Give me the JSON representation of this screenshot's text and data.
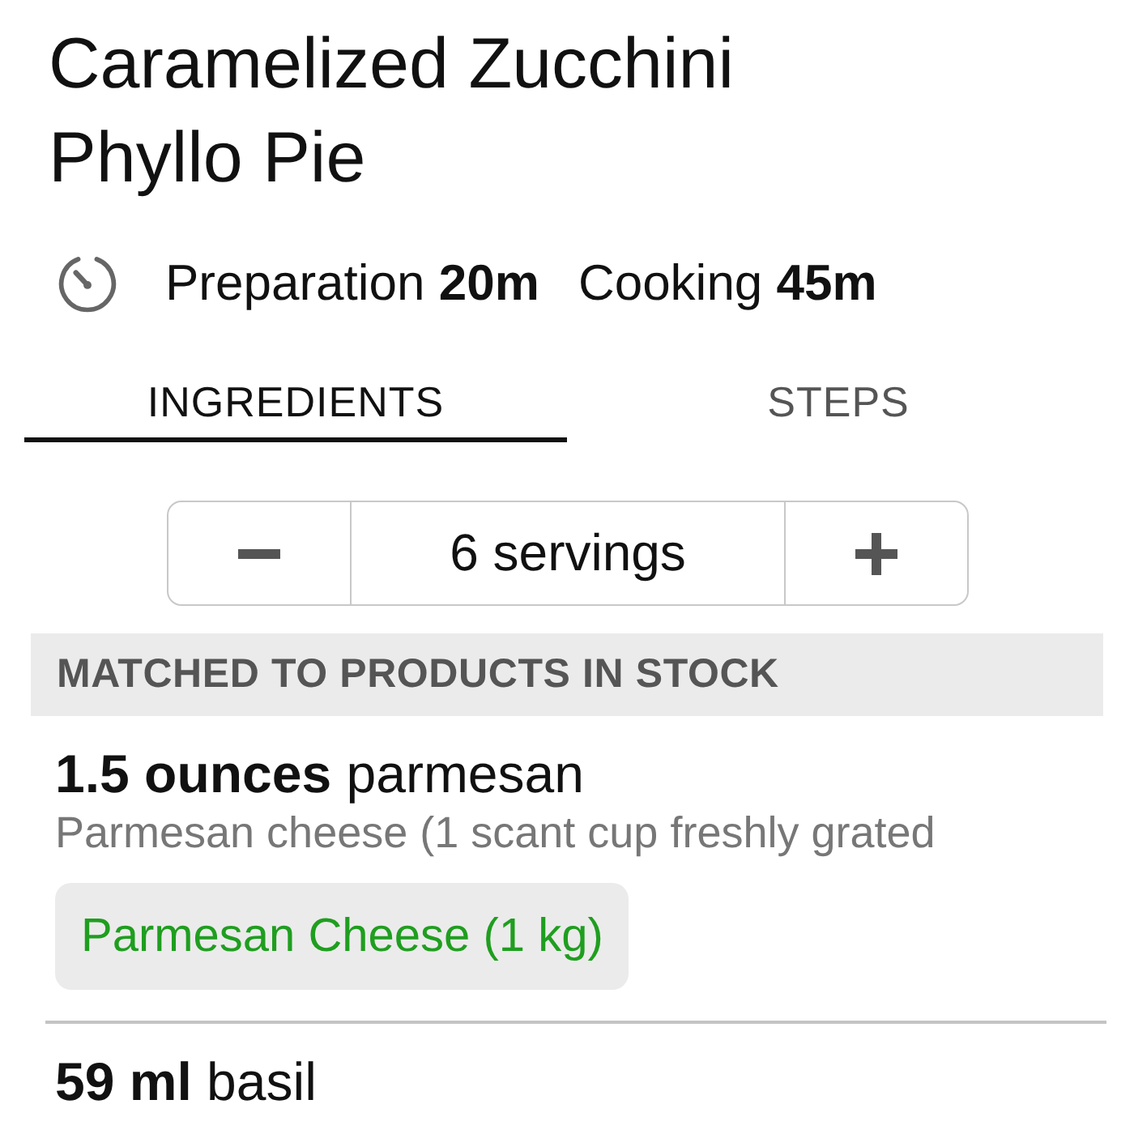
{
  "recipe": {
    "title": "Caramelized Zucchini Phyllo Pie",
    "times": [
      {
        "label": "Preparation",
        "value": "20m"
      },
      {
        "label": "Cooking",
        "value": "45m"
      }
    ]
  },
  "tabs": [
    {
      "label": "INGREDIENTS",
      "selected": true
    },
    {
      "label": "STEPS",
      "selected": false
    }
  ],
  "servings": {
    "value": "6 servings"
  },
  "sections": [
    {
      "heading": "MATCHED TO PRODUCTS IN STOCK",
      "ingredients": [
        {
          "line": "**1.5 ounces** parmesan",
          "note": "Parmesan cheese (1 scant cup freshly grated",
          "product": "Parmesan Cheese (1 kg)"
        },
        {
          "line": "**59 ml** basil"
        }
      ]
    }
  ]
}
